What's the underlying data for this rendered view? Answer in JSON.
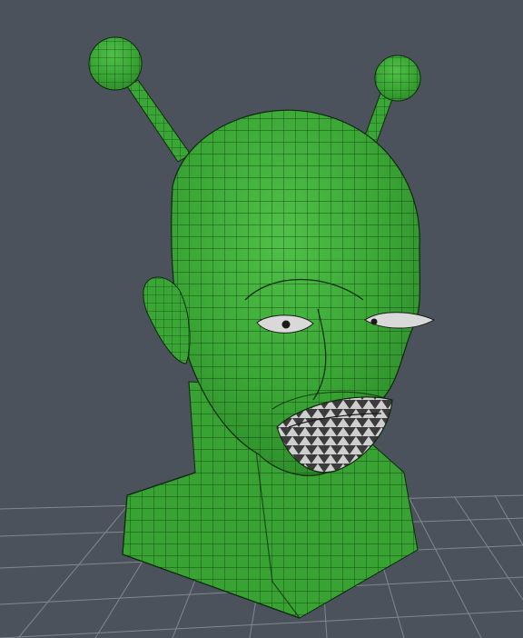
{
  "viewport": {
    "background_color": "#4b525c",
    "grid_color": "#8a919b",
    "mesh_fill_color": "#3aa635",
    "mesh_shadow_color": "#2d8a2a",
    "mesh_highlight_color": "#4fc048",
    "wireframe_color": "#0d2a0c",
    "eye_color": "#d9d9d9",
    "mouth_color": "#bcbcbc"
  },
  "model": {
    "icon": "green-alien-head-mesh-icon",
    "parts": [
      "head",
      "neck",
      "antenna-left",
      "antenna-right",
      "ear",
      "eye-left",
      "eye-right",
      "mouth"
    ]
  }
}
